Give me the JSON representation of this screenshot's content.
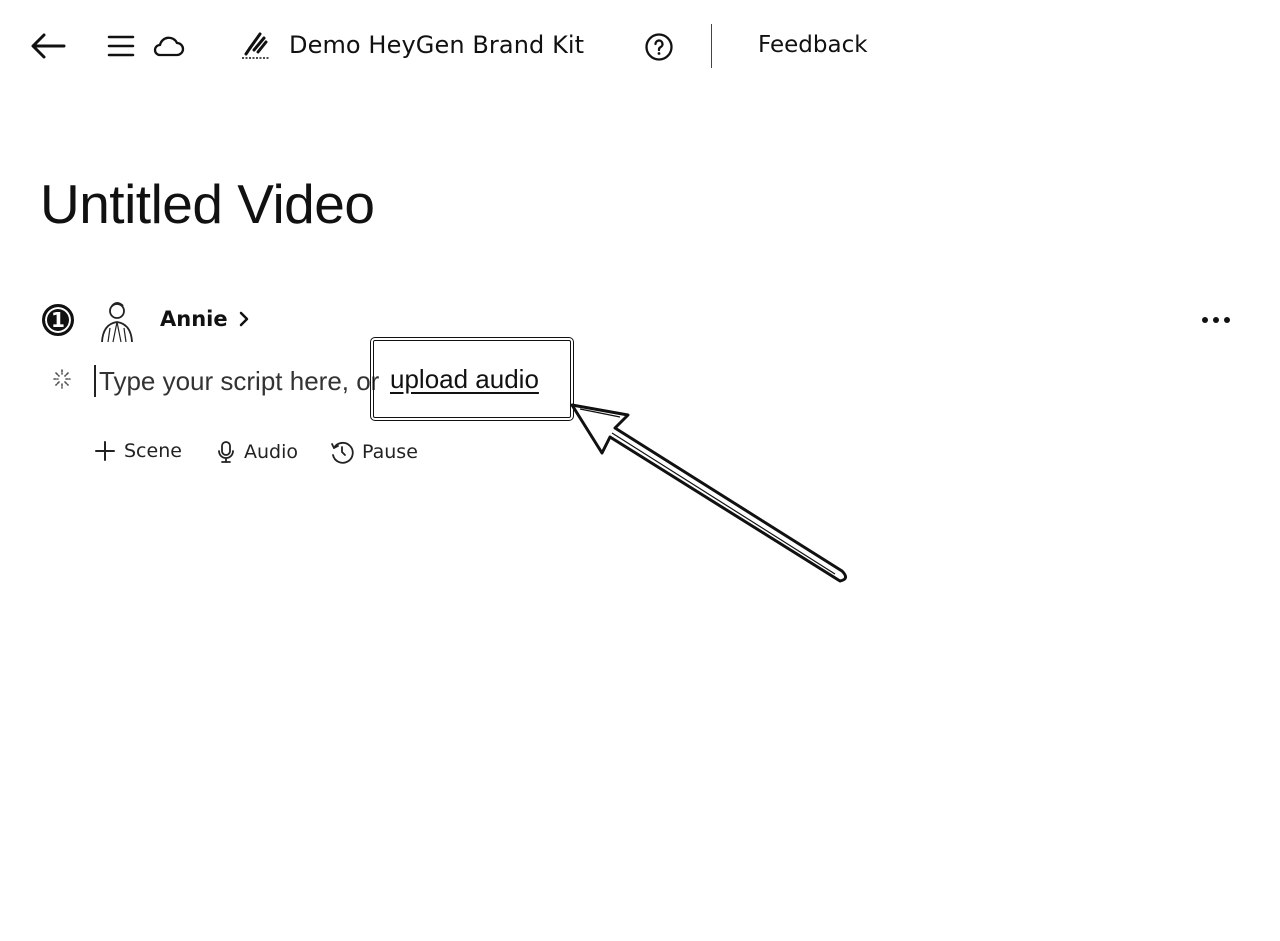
{
  "header": {
    "brand_kit_name": "Demo HeyGen Brand Kit",
    "feedback_label": "Feedback",
    "icons": [
      "back-arrow-icon",
      "menu-icon",
      "cloud-icon",
      "brand-logo-icon",
      "help-icon"
    ]
  },
  "title": "Untitled Video",
  "scene": {
    "number": "1",
    "avatar_name": "Annie",
    "script_placeholder": "Type your script here, or",
    "upload_link": "upload audio"
  },
  "toolbar": {
    "scene_label": "Scene",
    "audio_label": "Audio",
    "pause_label": "Pause"
  },
  "colors": {
    "text": "#111111",
    "background": "#ffffff"
  }
}
